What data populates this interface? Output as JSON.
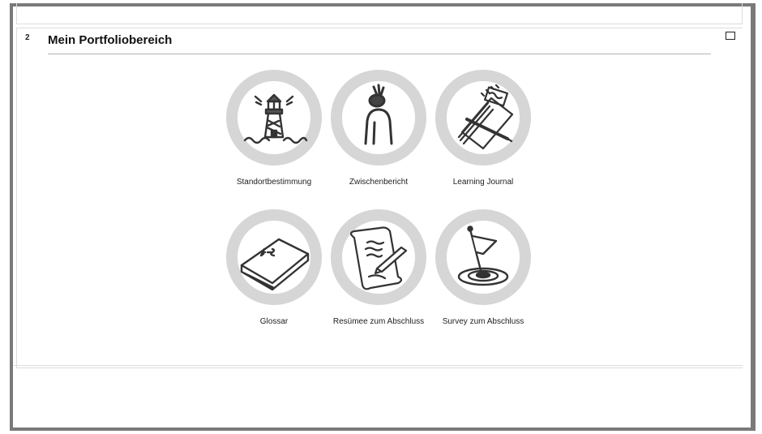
{
  "section": {
    "number": "2",
    "title": "Mein Portfoliobereich"
  },
  "activities": [
    {
      "label": "Standortbestimmung",
      "icon": "lighthouse-icon"
    },
    {
      "label": "Zwischenbericht",
      "icon": "person-icon"
    },
    {
      "label": "Learning Journal",
      "icon": "journal-icon"
    },
    {
      "label": "Glossar",
      "icon": "book-icon"
    },
    {
      "label": "Resümee zum Abschluss",
      "icon": "scroll-pen-icon"
    },
    {
      "label": "Survey zum Abschluss",
      "icon": "flag-target-icon"
    }
  ],
  "colors": {
    "disc_ring": "#d6d6d6",
    "disc_fill": "#ffffff",
    "ink": "#333333",
    "frame": "#7a7a7a"
  }
}
